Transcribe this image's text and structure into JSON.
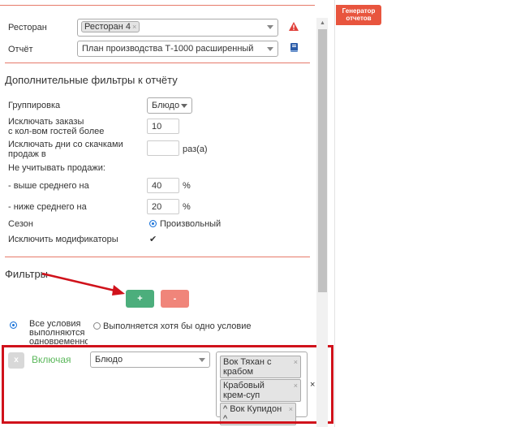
{
  "side_tab": {
    "label": "Генератор отчетов"
  },
  "form": {
    "restaurant": {
      "label": "Ресторан",
      "tag": "Ресторан 4",
      "tag_remove": "×"
    },
    "report": {
      "label": "Отчёт",
      "value": "План производства Т-1000 расширенный"
    }
  },
  "extra_filters": {
    "title": "Дополнительные фильтры к отчёту",
    "grouping": {
      "label": "Группировка",
      "value": "Блюдо"
    },
    "exclude_orders": {
      "label_line1": "Исключать заказы",
      "label_line2": "с кол-вом гостей более",
      "value": "10"
    },
    "exclude_days": {
      "label_line1": "Исключать дни со скачками",
      "label_line2": "продаж в",
      "value": "",
      "unit": "раз(а)"
    },
    "ignore_sales": {
      "label": "Не учитывать продажи:"
    },
    "above_avg": {
      "label": "- выше среднего на",
      "value": "40",
      "unit": "%"
    },
    "below_avg": {
      "label": "- ниже среднего на",
      "value": "20",
      "unit": "%"
    },
    "season": {
      "label": "Сезон",
      "option": "Произвольный"
    },
    "exclude_modifiers": {
      "label": "Исключить модификаторы",
      "checked": true,
      "mark": "✔"
    }
  },
  "filters": {
    "title": "Фильтры",
    "add_label": "+",
    "remove_label": "-",
    "condition_all": "Все условия выполняются одновременно",
    "condition_any": "Выполняется хотя бы одно условие",
    "rule": {
      "remove_label": "x",
      "mode": "Включая",
      "field": "Блюдо",
      "values": [
        "Вок Тяхан с крабом",
        "Крабовый крем-суп",
        "^ Вок Купидон ^"
      ],
      "clear_label": "×"
    }
  },
  "colors": {
    "accent_red": "#e8553e",
    "add_green": "#4cae7c",
    "remove_red": "#f0857a",
    "include_green": "#5cb85c",
    "highlight": "#d0121b"
  }
}
